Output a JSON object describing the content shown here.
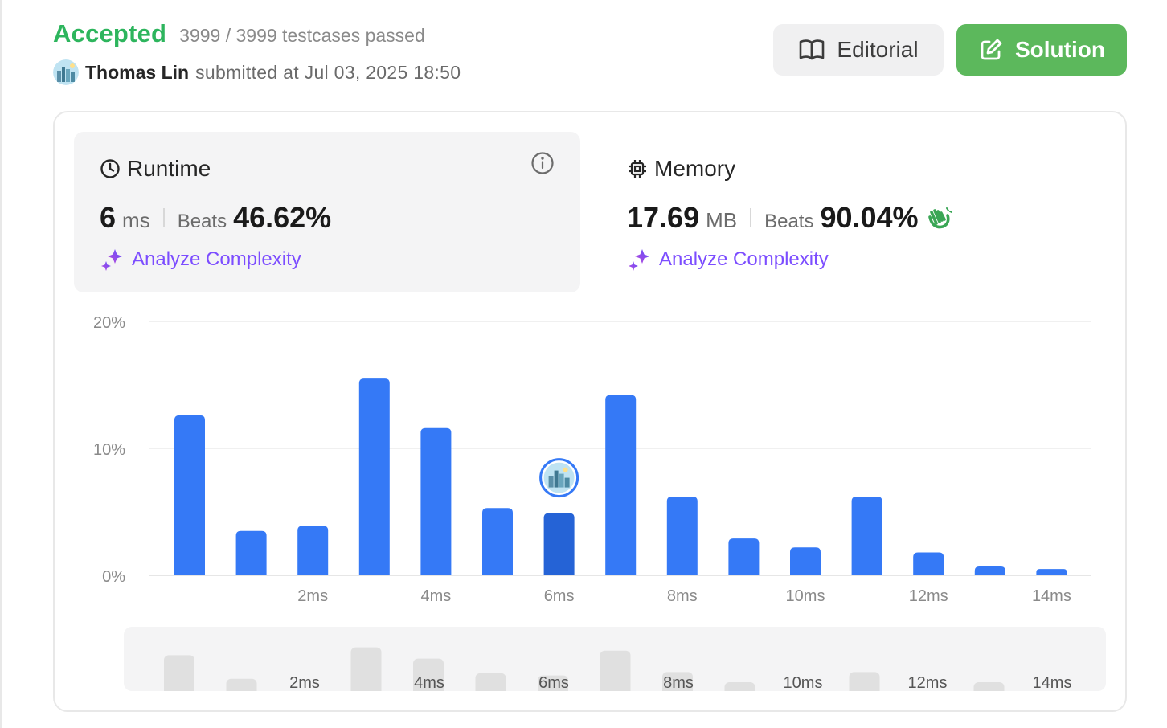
{
  "header": {
    "status": "Accepted",
    "testcases": "3999 / 3999 testcases passed",
    "user": "Thomas Lin",
    "submitted": "submitted at Jul 03, 2025 18:50",
    "editorial_label": "Editorial",
    "solution_label": "Solution"
  },
  "runtime": {
    "title": "Runtime",
    "value": "6",
    "unit": "ms",
    "beats_label": "Beats",
    "beats": "46.62%",
    "analyze_label": "Analyze Complexity"
  },
  "memory": {
    "title": "Memory",
    "value": "17.69",
    "unit": "MB",
    "beats_label": "Beats",
    "beats": "90.04%",
    "analyze_label": "Analyze Complexity"
  },
  "colors": {
    "accepted": "#2db55d",
    "solution_button": "#5cb85c",
    "bar": "#3579f6",
    "bar_highlight": "#2563d6",
    "accent_purple": "#7c4dff",
    "minimap_bar": "#e0e0e0"
  },
  "chart_data": {
    "type": "bar",
    "x": [
      1,
      2,
      3,
      4,
      5,
      6,
      7,
      8,
      9,
      10,
      11,
      12,
      13,
      14,
      15
    ],
    "values": [
      12.6,
      3.5,
      3.9,
      15.5,
      11.6,
      5.3,
      4.9,
      14.2,
      6.2,
      2.9,
      2.2,
      6.2,
      1.8,
      0.7,
      0.5
    ],
    "highlight_x": 7,
    "xticks": [
      {
        "x": 3,
        "label": "2ms"
      },
      {
        "x": 5,
        "label": "4ms"
      },
      {
        "x": 7,
        "label": "6ms"
      },
      {
        "x": 9,
        "label": "8ms"
      },
      {
        "x": 11,
        "label": "10ms"
      },
      {
        "x": 13,
        "label": "12ms"
      },
      {
        "x": 15,
        "label": "14ms"
      }
    ],
    "yticks": [
      {
        "v": 0,
        "label": "0%"
      },
      {
        "v": 10,
        "label": "10%"
      },
      {
        "v": 20,
        "label": "20%"
      }
    ],
    "ylim": [
      0,
      20
    ],
    "grid": true,
    "minimap_values": [
      2.9,
      0.8,
      0,
      3.6,
      2.6,
      1.3,
      1.1,
      3.3,
      1.4,
      0.5,
      0,
      1.4,
      0,
      0.5,
      0
    ]
  }
}
